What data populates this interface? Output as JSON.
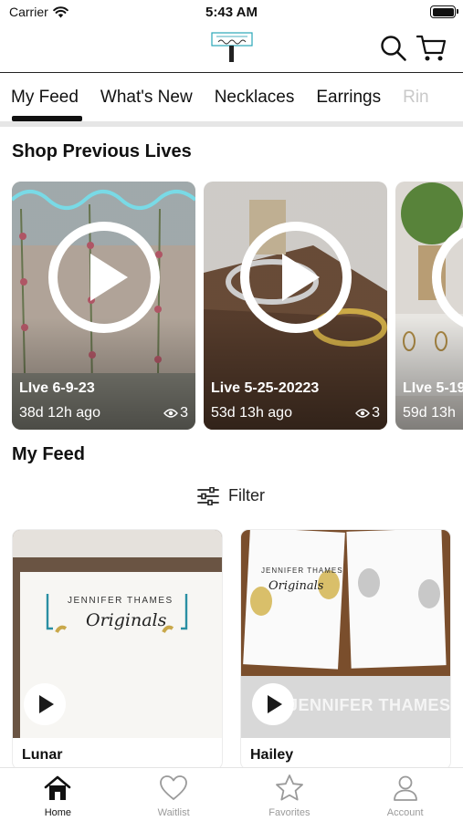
{
  "status_bar": {
    "carrier": "Carrier",
    "time": "5:43 AM"
  },
  "header": {
    "logo_icon": "jennifer-thames-originals-logo",
    "search_icon": "search-icon",
    "cart_icon": "cart-icon"
  },
  "tabs": [
    {
      "label": "My Feed"
    },
    {
      "label": "What's New"
    },
    {
      "label": "Necklaces"
    },
    {
      "label": "Earrings"
    },
    {
      "label": "Rin"
    }
  ],
  "sections": {
    "previous_lives": "Shop Previous Lives",
    "my_feed": "My Feed"
  },
  "lives": [
    {
      "title": "LIve 6-9-23",
      "ago": "38d 12h ago",
      "views": "3"
    },
    {
      "title": "Live 5-25-20223",
      "ago": "53d 13h ago",
      "views": "3"
    },
    {
      "title": "LIve 5-19",
      "ago": "59d 13h",
      "views": ""
    }
  ],
  "filter": {
    "label": "Filter",
    "icon": "sliders-icon"
  },
  "products": [
    {
      "name": "Lunar",
      "card_brand": "JENNIFER THAMES",
      "card_script": "Originals"
    },
    {
      "name": "Hailey",
      "card_brand": "JENNIFER THAMES",
      "card_script": "Originals",
      "watermark": "JENNIFER THAMES ORIGINALS"
    }
  ],
  "bottom_nav": [
    {
      "label": "Home",
      "icon": "home-icon",
      "active": true
    },
    {
      "label": "Waitlist",
      "icon": "heart-icon",
      "active": false
    },
    {
      "label": "Favorites",
      "icon": "star-icon",
      "active": false
    },
    {
      "label": "Account",
      "icon": "person-icon",
      "active": false
    }
  ]
}
